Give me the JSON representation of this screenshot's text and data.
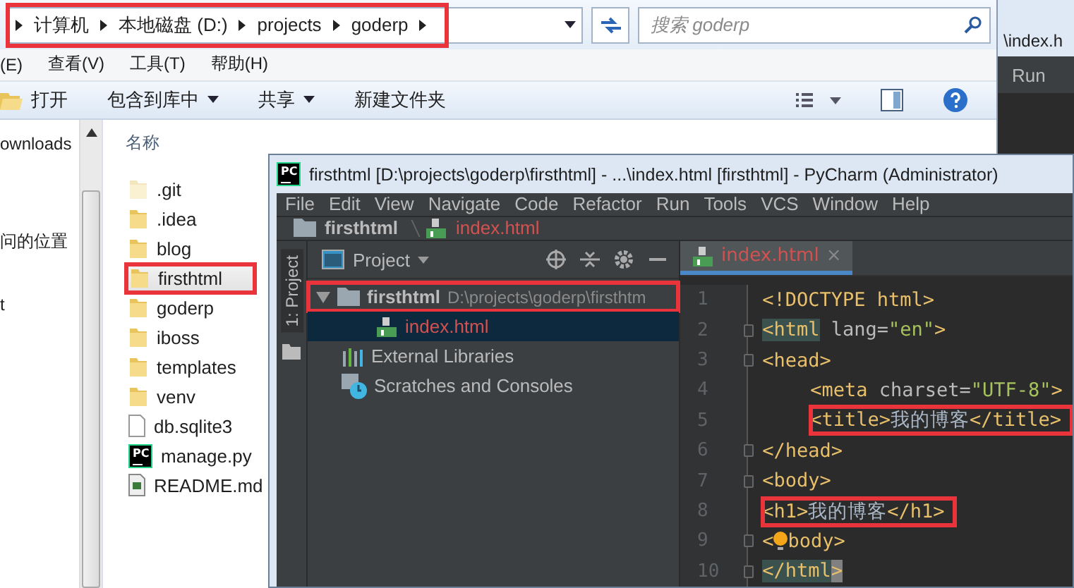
{
  "explorer": {
    "address": {
      "highlighted": true,
      "crumbs": [
        "计算机",
        "本地磁盘 (D:)",
        "projects",
        "goderp"
      ]
    },
    "search": {
      "placeholder": "搜索 goderp"
    },
    "menu": [
      "(E)",
      "查看(V)",
      "工具(T)",
      "帮助(H)"
    ],
    "toolbar": [
      {
        "label": "打开",
        "kind": "open"
      },
      {
        "label": "包含到库中",
        "kind": "dropdown"
      },
      {
        "label": "共享",
        "kind": "dropdown"
      },
      {
        "label": "新建文件夹",
        "kind": "plain"
      }
    ],
    "nav": [
      "ownloads",
      "问的位置",
      "t"
    ],
    "columns": [
      "名称"
    ],
    "files": [
      {
        "name": ".git",
        "kind": "folder",
        "hidden": true,
        "selected": false,
        "highlighted": false
      },
      {
        "name": ".idea",
        "kind": "folder",
        "hidden": false,
        "selected": false,
        "highlighted": false
      },
      {
        "name": "blog",
        "kind": "folder",
        "hidden": false,
        "selected": false,
        "highlighted": false
      },
      {
        "name": "firsthtml",
        "kind": "folder",
        "hidden": false,
        "selected": true,
        "highlighted": true
      },
      {
        "name": "goderp",
        "kind": "folder",
        "hidden": false,
        "selected": false,
        "highlighted": false
      },
      {
        "name": "iboss",
        "kind": "folder",
        "hidden": false,
        "selected": false,
        "highlighted": false
      },
      {
        "name": "templates",
        "kind": "folder",
        "hidden": false,
        "selected": false,
        "highlighted": false
      },
      {
        "name": "venv",
        "kind": "folder",
        "hidden": false,
        "selected": false,
        "highlighted": false
      },
      {
        "name": "db.sqlite3",
        "kind": "file",
        "selected": false,
        "highlighted": false
      },
      {
        "name": "manage.py",
        "kind": "pycharm",
        "logo": "PC",
        "selected": false,
        "highlighted": false
      },
      {
        "name": "README.md",
        "kind": "markdown",
        "selected": false,
        "highlighted": false
      }
    ]
  },
  "background_window": {
    "title": "\\index.h",
    "menu": "Run"
  },
  "pycharm": {
    "logo": "PC",
    "title": "firsthtml [D:\\projects\\goderp\\firsthtml] - ...\\index.html [firsthtml] - PyCharm (Administrator)",
    "menu": [
      "File",
      "Edit",
      "View",
      "Navigate",
      "Code",
      "Refactor",
      "Run",
      "Tools",
      "VCS",
      "Window",
      "Help"
    ],
    "breadcrumb": [
      {
        "label": "firsthtml",
        "kind": "folder"
      },
      {
        "label": "index.html",
        "kind": "html"
      }
    ],
    "side_tab": "1: Project",
    "panel_title": "Project",
    "tree": [
      {
        "label": "firsthtml",
        "path": "D:\\projects\\goderp\\firsthtm",
        "kind": "folder",
        "expanded": true,
        "selected": false,
        "highlighted": true,
        "children": [
          {
            "label": "index.html",
            "kind": "html",
            "selected": true,
            "highlighted": false
          }
        ]
      },
      {
        "label": "External Libraries",
        "kind": "library",
        "selected": false,
        "highlighted": false
      },
      {
        "label": "Scratches and Consoles",
        "kind": "scratch",
        "selected": false,
        "highlighted": false
      }
    ],
    "tab": {
      "label": "index.html",
      "close": "×",
      "selected": true
    },
    "lines": [
      {
        "number": "1",
        "fold": false,
        "indented": false,
        "highlighted": false,
        "tokens": [
          {
            "kind": "tag",
            "text": "<!DOCTYPE html>"
          }
        ]
      },
      {
        "number": "2",
        "fold": true,
        "indented": false,
        "highlighted": false,
        "tokens": [
          {
            "kind": "match",
            "text": "<html"
          },
          {
            "kind": "attr",
            "text": " lang="
          },
          {
            "kind": "string",
            "text": "\"en\""
          },
          {
            "kind": "tag",
            "text": ">"
          }
        ]
      },
      {
        "number": "3",
        "fold": true,
        "indented": false,
        "highlighted": false,
        "tokens": [
          {
            "kind": "tag",
            "text": "<head>"
          }
        ]
      },
      {
        "number": "4",
        "fold": false,
        "indented": true,
        "highlighted": false,
        "tokens": [
          {
            "kind": "tag",
            "text": "<meta"
          },
          {
            "kind": "attr",
            "text": " charset="
          },
          {
            "kind": "string",
            "text": "\"UTF-8\""
          },
          {
            "kind": "tag",
            "text": ">"
          }
        ]
      },
      {
        "number": "5",
        "fold": false,
        "indented": true,
        "highlighted": true,
        "tokens": [
          {
            "kind": "tag",
            "text": "<title>"
          },
          {
            "kind": "plain",
            "text": "我的博客"
          },
          {
            "kind": "tag",
            "text": "</title>"
          }
        ]
      },
      {
        "number": "6",
        "fold": true,
        "indented": false,
        "highlighted": false,
        "tokens": [
          {
            "kind": "tag",
            "text": "</head>"
          }
        ]
      },
      {
        "number": "7",
        "fold": true,
        "indented": false,
        "highlighted": false,
        "tokens": [
          {
            "kind": "tag",
            "text": "<body>"
          }
        ]
      },
      {
        "number": "8",
        "fold": false,
        "indented": false,
        "highlighted": true,
        "tokens": [
          {
            "kind": "tag",
            "text": "<h1>"
          },
          {
            "kind": "plain",
            "text": "我的博客"
          },
          {
            "kind": "tag",
            "text": "</h1>"
          }
        ]
      },
      {
        "number": "9",
        "fold": true,
        "indented": false,
        "highlighted": false,
        "tokens": [
          {
            "kind": "tag",
            "text": "<"
          },
          {
            "kind": "bulb"
          },
          {
            "kind": "tag",
            "text": "body>"
          }
        ]
      },
      {
        "number": "10",
        "fold": true,
        "indented": false,
        "highlighted": false,
        "tokens": [
          {
            "kind": "match",
            "text": "</html"
          },
          {
            "kind": "caret",
            "text": ">"
          }
        ]
      }
    ]
  }
}
